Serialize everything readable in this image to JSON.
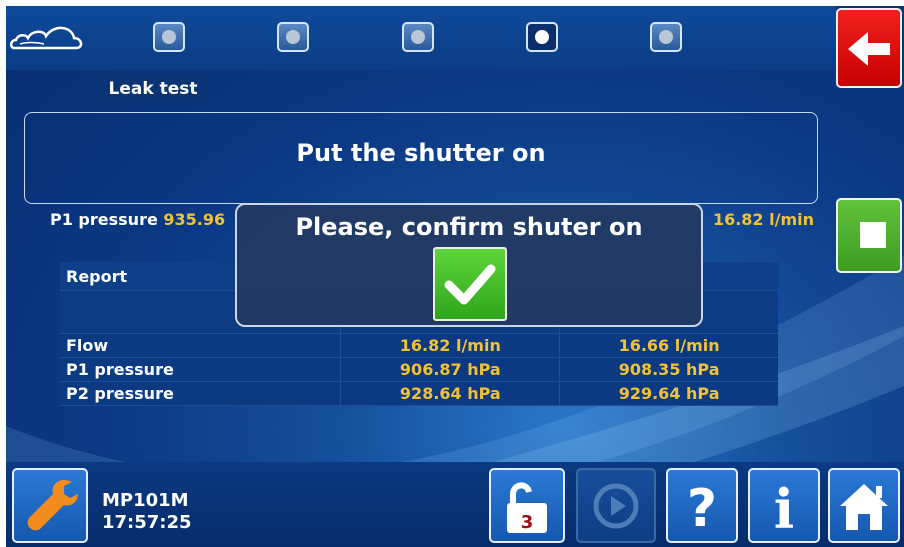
{
  "header": {
    "screen_title": "Leak test",
    "steps": [
      {
        "name": "step-1",
        "active": false
      },
      {
        "name": "step-2",
        "active": false
      },
      {
        "name": "step-3",
        "active": false
      },
      {
        "name": "step-4",
        "active": true
      },
      {
        "name": "step-5",
        "active": false
      }
    ],
    "logo_icon": "cloud-logo-icon",
    "back_icon": "arrow-left-icon"
  },
  "message": {
    "text": "Put the shutter on"
  },
  "measurements": {
    "p1_label": "P1 pressure",
    "p1_value": "935.96",
    "flow_value": "16.82 l/min"
  },
  "report": {
    "header_label": "Report",
    "columns": [
      "",
      ""
    ],
    "rows": [
      {
        "label": "Flow",
        "values": [
          "16.82 l/min",
          "16.66 l/min"
        ]
      },
      {
        "label": "P1 pressure",
        "values": [
          "906.87 hPa",
          "908.35 hPa"
        ]
      },
      {
        "label": "P2 pressure",
        "values": [
          "928.64 hPa",
          "929.64 hPa"
        ]
      }
    ]
  },
  "dialog": {
    "text": "Please, confirm shuter on",
    "confirm_icon": "checkmark-icon"
  },
  "footer": {
    "device_name": "MP101M",
    "time": "17:57:25",
    "lock_badge": "3",
    "icons": [
      "wrench-icon",
      "unlock-icon",
      "play-icon",
      "help-icon",
      "info-icon",
      "home-icon"
    ]
  },
  "colors": {
    "value_accent": "#f2c233",
    "back_button": "#e01010",
    "stop_button": "#4caf2c",
    "confirm_button": "#3cb82a",
    "background": "#0c3a86"
  }
}
